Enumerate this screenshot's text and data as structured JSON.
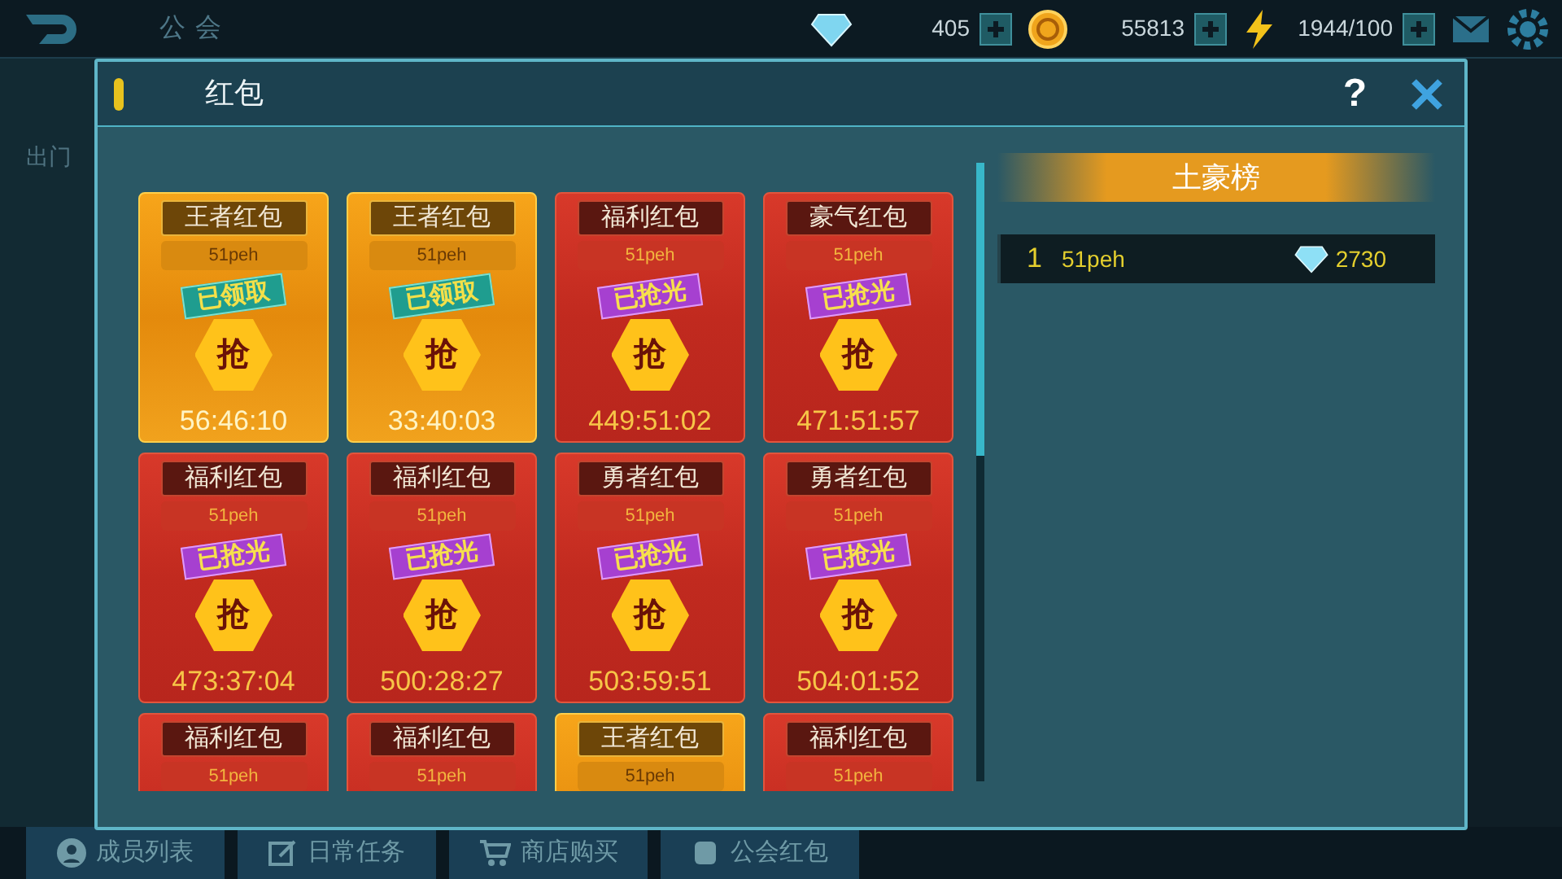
{
  "top_bar": {
    "title": "公会",
    "resources": [
      {
        "kind": "diamond",
        "value": "405"
      },
      {
        "kind": "coin",
        "value": "55813"
      },
      {
        "kind": "energy",
        "value": "1944/100"
      }
    ]
  },
  "background": {
    "side_label": "出门"
  },
  "dialog": {
    "title": "红包",
    "help": "?"
  },
  "packets": [
    {
      "kind": "gold",
      "title": "王者红包",
      "sender": "51peh",
      "claimed": true,
      "stamp": "已领取",
      "grab": "抢",
      "time": "56:46:10"
    },
    {
      "kind": "gold",
      "title": "王者红包",
      "sender": "51peh",
      "claimed": true,
      "stamp": "已领取",
      "grab": "抢",
      "time": "33:40:03"
    },
    {
      "kind": "red",
      "title": "福利红包",
      "sender": "51peh",
      "claimed": false,
      "stamp": "已抢光",
      "grab": "抢",
      "time": "449:51:02"
    },
    {
      "kind": "red",
      "title": "豪气红包",
      "sender": "51peh",
      "claimed": false,
      "stamp": "已抢光",
      "grab": "抢",
      "time": "471:51:57"
    },
    {
      "kind": "red",
      "title": "福利红包",
      "sender": "51peh",
      "claimed": false,
      "stamp": "已抢光",
      "grab": "抢",
      "time": "473:37:04"
    },
    {
      "kind": "red",
      "title": "福利红包",
      "sender": "51peh",
      "claimed": false,
      "stamp": "已抢光",
      "grab": "抢",
      "time": "500:28:27"
    },
    {
      "kind": "red",
      "title": "勇者红包",
      "sender": "51peh",
      "claimed": false,
      "stamp": "已抢光",
      "grab": "抢",
      "time": "503:59:51"
    },
    {
      "kind": "red",
      "title": "勇者红包",
      "sender": "51peh",
      "claimed": false,
      "stamp": "已抢光",
      "grab": "抢",
      "time": "504:01:52"
    },
    {
      "kind": "red",
      "title": "福利红包",
      "sender": "51peh"
    },
    {
      "kind": "red",
      "title": "福利红包",
      "sender": "51peh"
    },
    {
      "kind": "gold",
      "title": "王者红包",
      "sender": "51peh"
    },
    {
      "kind": "red",
      "title": "福利红包",
      "sender": "51peh"
    }
  ],
  "leaderboard": {
    "title": "土豪榜",
    "rows": [
      {
        "rank": "1",
        "name": "51peh",
        "amount": "2730"
      }
    ]
  },
  "bottom_tabs": [
    {
      "kind": "members",
      "label": "成员列表"
    },
    {
      "kind": "tasks",
      "label": "日常任务"
    },
    {
      "kind": "shop",
      "label": "商店购买"
    },
    {
      "kind": "packets",
      "label": "公会红包"
    }
  ]
}
